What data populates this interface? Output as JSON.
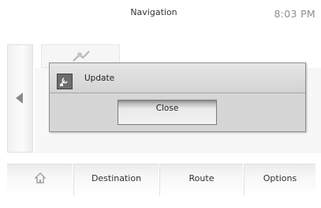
{
  "header": {
    "title": "Navigation",
    "clock": "8:03 PM"
  },
  "icons": {
    "back": "triangle-left-icon",
    "background_tile": "map-icon",
    "dialog": "update-icon",
    "home": "home-icon"
  },
  "dialog": {
    "title": "Update",
    "close_label": "Close"
  },
  "tabs": [
    {
      "label": ""
    },
    {
      "label": "Destination"
    },
    {
      "label": "Route"
    },
    {
      "label": "Options"
    }
  ],
  "colors": {
    "dialog_bg": "#dcdcdc",
    "dialog_border": "#8e8e8e",
    "icon_gray": "#a0a0a0"
  }
}
